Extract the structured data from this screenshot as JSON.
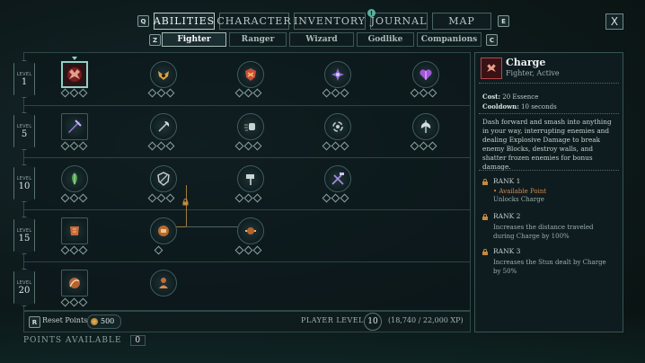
{
  "nav": {
    "left_key": "Q",
    "right_key": "E",
    "tabs": [
      {
        "label": "ABILITIES",
        "active": true
      },
      {
        "label": "CHARACTER",
        "active": false
      },
      {
        "label": "INVENTORY",
        "active": false
      },
      {
        "label": "JOURNAL",
        "active": false,
        "notification": "!"
      },
      {
        "label": "MAP",
        "active": false
      }
    ],
    "close_label": "X"
  },
  "subnav": {
    "left_key": "Z",
    "right_key": "C",
    "tabs": [
      {
        "label": "Fighter",
        "active": true
      },
      {
        "label": "Ranger",
        "active": false
      },
      {
        "label": "Wizard",
        "active": false
      },
      {
        "label": "Godlike",
        "active": false
      },
      {
        "label": "Companions",
        "active": false
      }
    ]
  },
  "levels": [
    {
      "label": "LEVEL",
      "value": "1"
    },
    {
      "label": "LEVEL",
      "value": "5"
    },
    {
      "label": "LEVEL",
      "value": "10"
    },
    {
      "label": "LEVEL",
      "value": "15"
    },
    {
      "label": "LEVEL",
      "value": "20"
    }
  ],
  "skills": {
    "row1": [
      "charge-icon",
      "bull-rush-icon",
      "shield-strike-icon",
      "arcane-sigil-icon",
      "heart-guard-icon"
    ],
    "row2": [
      "cleave-icon",
      "axe-swing-icon",
      "fist-blow-icon",
      "whirlwind-icon",
      "battle-axe-icon"
    ],
    "row3": [
      "nature-rune-icon",
      "shield-block-icon",
      "hammer-smash-icon",
      "crossed-hammers-icon"
    ],
    "row4": [
      "armor-stance-icon",
      "locked-shield-icon",
      "hammer-crest-icon"
    ],
    "row5": [
      "leap-slash-icon",
      "armored-warrior-icon"
    ]
  },
  "bottom": {
    "reset_key": "R",
    "reset_label": "Reset Points",
    "reset_cost": "500",
    "player_level_label": "PLAYER LEVEL",
    "player_level": "10",
    "xp": "(18,740 / 22,000 XP)",
    "points_available_label": "POINTS AVAILABLE",
    "points_available": "0"
  },
  "detail": {
    "title": "Charge",
    "subtitle": "Fighter, Active",
    "cost_label": "Cost:",
    "cost_value": "20 Essence",
    "cooldown_label": "Cooldown:",
    "cooldown_value": "10 seconds",
    "description": "Dash forward and smash into anything in your way, interrupting enemies and dealing Explosive Damage to break enemy Blocks, destroy walls, and shatter frozen enemies for bonus damage.",
    "ranks": [
      {
        "title": "RANK 1",
        "available": "• Available Point",
        "text": "Unlocks Charge"
      },
      {
        "title": "RANK 2",
        "text": "Increases the distance traveled during Charge by 100%"
      },
      {
        "title": "RANK 3",
        "text": "Increases the Stun dealt by Charge by 50%"
      }
    ]
  },
  "colors": {
    "accent": "#8fd1c4",
    "gold": "#d6884e",
    "bg": "#0e1b1d"
  }
}
